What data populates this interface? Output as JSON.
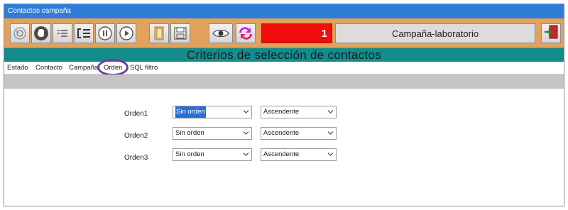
{
  "window": {
    "title": "Contactos campaña"
  },
  "toolbar": {
    "buttons": [
      {
        "name": "refresh-icon"
      },
      {
        "name": "stop-hand-icon"
      },
      {
        "name": "list-indent-icon"
      },
      {
        "name": "return-list-icon"
      },
      {
        "name": "pause-icon"
      },
      {
        "name": "play-icon"
      },
      {
        "name": "open-document-icon"
      },
      {
        "name": "save-icon"
      },
      {
        "name": "eye-icon"
      },
      {
        "name": "sync-arrows-icon"
      }
    ],
    "counter_value": "1",
    "campaign_name": "Campaña-laboratorio",
    "exit_icon": "exit-door-icon",
    "colors": {
      "toolbar": "#e2a25c",
      "counter": "#f20d0d",
      "header": "#148c8c",
      "title_bar": "#2f7dd8",
      "tab_ring": "#6f3aa6"
    }
  },
  "header": {
    "title": "Criterios de selección de contactos"
  },
  "tabs": {
    "items": [
      {
        "label": "Estado"
      },
      {
        "label": "Contacto"
      },
      {
        "label": "Campaña"
      },
      {
        "label": "Orden"
      },
      {
        "label": "SQL filtro"
      }
    ],
    "active": "Orden"
  },
  "form": {
    "rows": [
      {
        "label": "Orden1",
        "field": "Sin orden",
        "direction": "Ascendente"
      },
      {
        "label": "Orden2",
        "field": "Sin orden",
        "direction": "Ascendente"
      },
      {
        "label": "Orden3",
        "field": "Sin orden",
        "direction": "Ascendente"
      }
    ]
  }
}
